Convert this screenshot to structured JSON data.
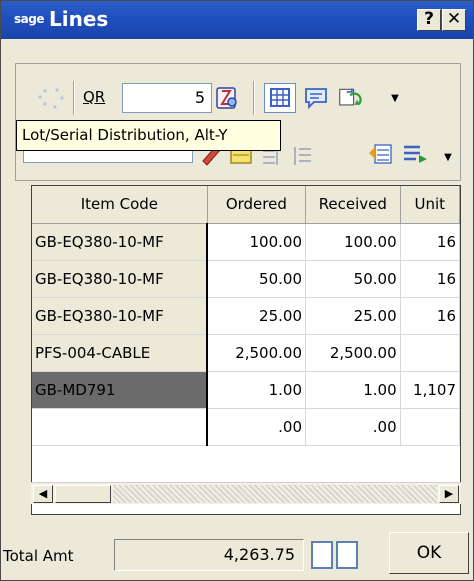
{
  "window": {
    "logo": "sage",
    "title": "Lines",
    "help_label": "?",
    "close_label": "✕"
  },
  "toolbar": {
    "qr_label": "QR",
    "qr_value": "5",
    "tooltip": "Lot/Serial Distribution, Alt-Y",
    "dropdown_arrow": "▼"
  },
  "grid": {
    "headers": [
      "Item Code",
      "Ordered",
      "Received",
      "Unit"
    ],
    "rows": [
      {
        "code": "GB-EQ380-10-MF",
        "ordered": "100.00",
        "received": "100.00",
        "unit": "16"
      },
      {
        "code": "GB-EQ380-10-MF",
        "ordered": "50.00",
        "received": "50.00",
        "unit": "16"
      },
      {
        "code": "GB-EQ380-10-MF",
        "ordered": "25.00",
        "received": "25.00",
        "unit": "16"
      },
      {
        "code": "PFS-004-CABLE",
        "ordered": "2,500.00",
        "received": "2,500.00",
        "unit": ""
      },
      {
        "code": "GB-MD791",
        "ordered": "1.00",
        "received": "1.00",
        "unit": "1,107"
      },
      {
        "code": "",
        "ordered": ".00",
        "received": ".00",
        "unit": ""
      }
    ],
    "scroll_left": "◀",
    "scroll_right": "▶"
  },
  "footer": {
    "total_label": "Total Amt",
    "total_value": "4,263.75",
    "ok_label": "OK"
  }
}
